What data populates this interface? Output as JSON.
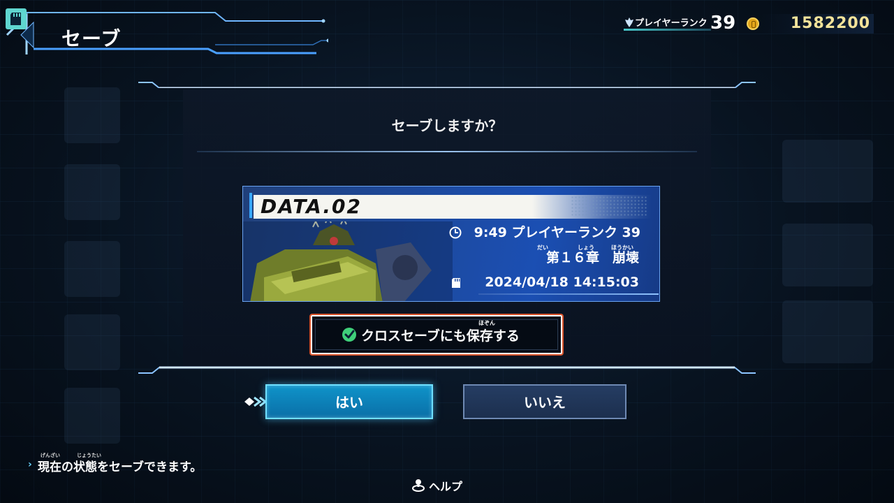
{
  "header": {
    "title": "セーブ",
    "icon": "sd-card-icon"
  },
  "status": {
    "rank_label": "プレイヤーランク",
    "rank_value": "39",
    "currency_icon": "coin-icon",
    "currency_value": "1582200"
  },
  "dialog": {
    "title": "セーブしますか？",
    "save_slot": {
      "name": "DATA.02",
      "playtime_and_rank": "9:49 プレイヤーランク 39",
      "chapter": "第１６章　崩壊",
      "chapter_ruby": {
        "dai": "だい",
        "shou": "しょう",
        "houkai": "ほうかい"
      },
      "timestamp": "2024/04/18 14:15:03",
      "icons": [
        "clock-icon",
        "sd-card-icon"
      ]
    },
    "cross_save": {
      "label": "クロスセーブにも保存する",
      "ruby": "ほぞん",
      "checked": true,
      "check_color": "#3fd07a"
    },
    "buttons": {
      "yes": "はい",
      "no": "いいえ"
    }
  },
  "footer": {
    "hint": "現在の状態をセーブできます。",
    "hint_ruby": {
      "genzai": "げんざい",
      "joutai": "じょうたい"
    },
    "help_label": "ヘルプ"
  },
  "colors": {
    "accent": "#38a9ff",
    "highlight_border": "#d9532a",
    "yes_button": "#0f93c9",
    "currency": "#f3e39a"
  }
}
